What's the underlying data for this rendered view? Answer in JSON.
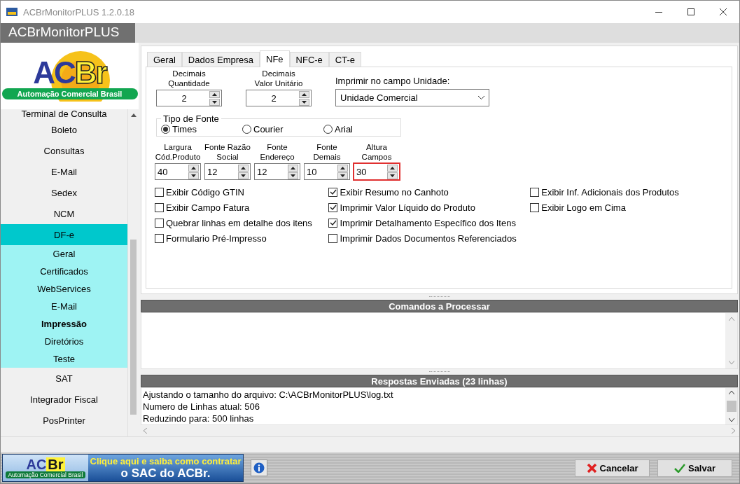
{
  "window": {
    "title": "ACBrMonitorPLUS 1.2.0.18"
  },
  "header": {
    "title": "ACBrMonitorPLUS"
  },
  "logo": {
    "mark_a": "AC",
    "mark_b": "Br",
    "tagline": "Automação Comercial Brasil"
  },
  "sidebar": {
    "items": [
      {
        "label": "Terminal de Consulta",
        "selected": false
      },
      {
        "label": "Boleto",
        "selected": false
      },
      {
        "label": "Consultas",
        "selected": false
      },
      {
        "label": "E-Mail",
        "selected": false
      },
      {
        "label": "Sedex",
        "selected": false
      },
      {
        "label": "NCM",
        "selected": false
      },
      {
        "label": "DF-e",
        "selected": true,
        "expanded": true,
        "children": [
          {
            "label": "Geral",
            "selected": false
          },
          {
            "label": "Certificados",
            "selected": false
          },
          {
            "label": "WebServices",
            "selected": false
          },
          {
            "label": "E-Mail",
            "selected": false
          },
          {
            "label": "Impressão",
            "selected": true
          },
          {
            "label": "Diretórios",
            "selected": false
          },
          {
            "label": "Teste",
            "selected": false
          }
        ]
      },
      {
        "label": "SAT",
        "selected": false
      },
      {
        "label": "Integrador Fiscal",
        "selected": false
      },
      {
        "label": "PosPrinter",
        "selected": false
      }
    ]
  },
  "tabs": [
    {
      "label": "Geral",
      "selected": false
    },
    {
      "label": "Dados Empresa",
      "selected": false
    },
    {
      "label": "NFe",
      "selected": true
    },
    {
      "label": "NFC-e",
      "selected": false
    },
    {
      "label": "CT-e",
      "selected": false
    }
  ],
  "decimals": [
    {
      "label_1": "Decimais",
      "label_2": "Quantidade",
      "value": "2"
    },
    {
      "label_1": "Decimais",
      "label_2": "Valor Unitário",
      "value": "2"
    }
  ],
  "unit_field": {
    "label": "Imprimir no campo Unidade:",
    "value": "Unidade Comercial"
  },
  "font_type": {
    "title": "Tipo de Fonte",
    "options": [
      {
        "label": "Times",
        "selected": true
      },
      {
        "label": "Courier",
        "selected": false
      },
      {
        "label": "Arial",
        "selected": false
      }
    ]
  },
  "sizes": [
    {
      "label_1": "Largura",
      "label_2": "Cód.Produto",
      "value": "40",
      "focused": false
    },
    {
      "label_1": "Fonte Razão",
      "label_2": "Social",
      "value": "12",
      "focused": false
    },
    {
      "label_1": "Fonte",
      "label_2": "Endereço",
      "value": "12",
      "focused": false
    },
    {
      "label_1": "Fonte",
      "label_2": "Demais",
      "value": "10",
      "focused": false
    },
    {
      "label_1": "Altura",
      "label_2": "Campos",
      "value": "30",
      "focused": true
    }
  ],
  "checkbox_columns": [
    [
      {
        "label": "Exibir Código GTIN",
        "checked": false
      },
      {
        "label": "Exibir Campo Fatura",
        "checked": false
      },
      {
        "label": "Quebrar linhas em detalhe dos itens",
        "checked": false
      },
      {
        "label": "Formulario Pré-Impresso",
        "checked": false
      }
    ],
    [
      {
        "label": "Exibir Resumo no Canhoto",
        "checked": true
      },
      {
        "label": "Imprimir Valor Líquido do Produto",
        "checked": true
      },
      {
        "label": "Imprimir Detalhamento Específico dos Itens",
        "checked": true
      },
      {
        "label": "Imprimir Dados Documentos Referenciados",
        "checked": false
      }
    ],
    [
      {
        "label": "Exibir Inf. Adicionais dos Produtos",
        "checked": false
      },
      {
        "label": "Exibir Logo em Cima",
        "checked": false
      }
    ]
  ],
  "commands_panel": {
    "title": "Comandos a Processar"
  },
  "responses_panel": {
    "title": "Respostas Enviadas (23 linhas)",
    "lines": [
      "Ajustando o tamanho do arquivo: C:\\ACBrMonitorPLUS\\log.txt",
      "Numero de Linhas atual: 506",
      "Reduzindo para: 500 linhas"
    ]
  },
  "banner": {
    "mark_a": "AC",
    "mark_b": "Br",
    "tagline": "Automação Comercial Brasil",
    "line_1": "Clique aqui e saiba como contratar",
    "line_2": "o SAC do ACBr."
  },
  "buttons": [
    {
      "kind": "cancel",
      "label": "Cancelar"
    },
    {
      "kind": "save",
      "label": "Salvar"
    }
  ]
}
